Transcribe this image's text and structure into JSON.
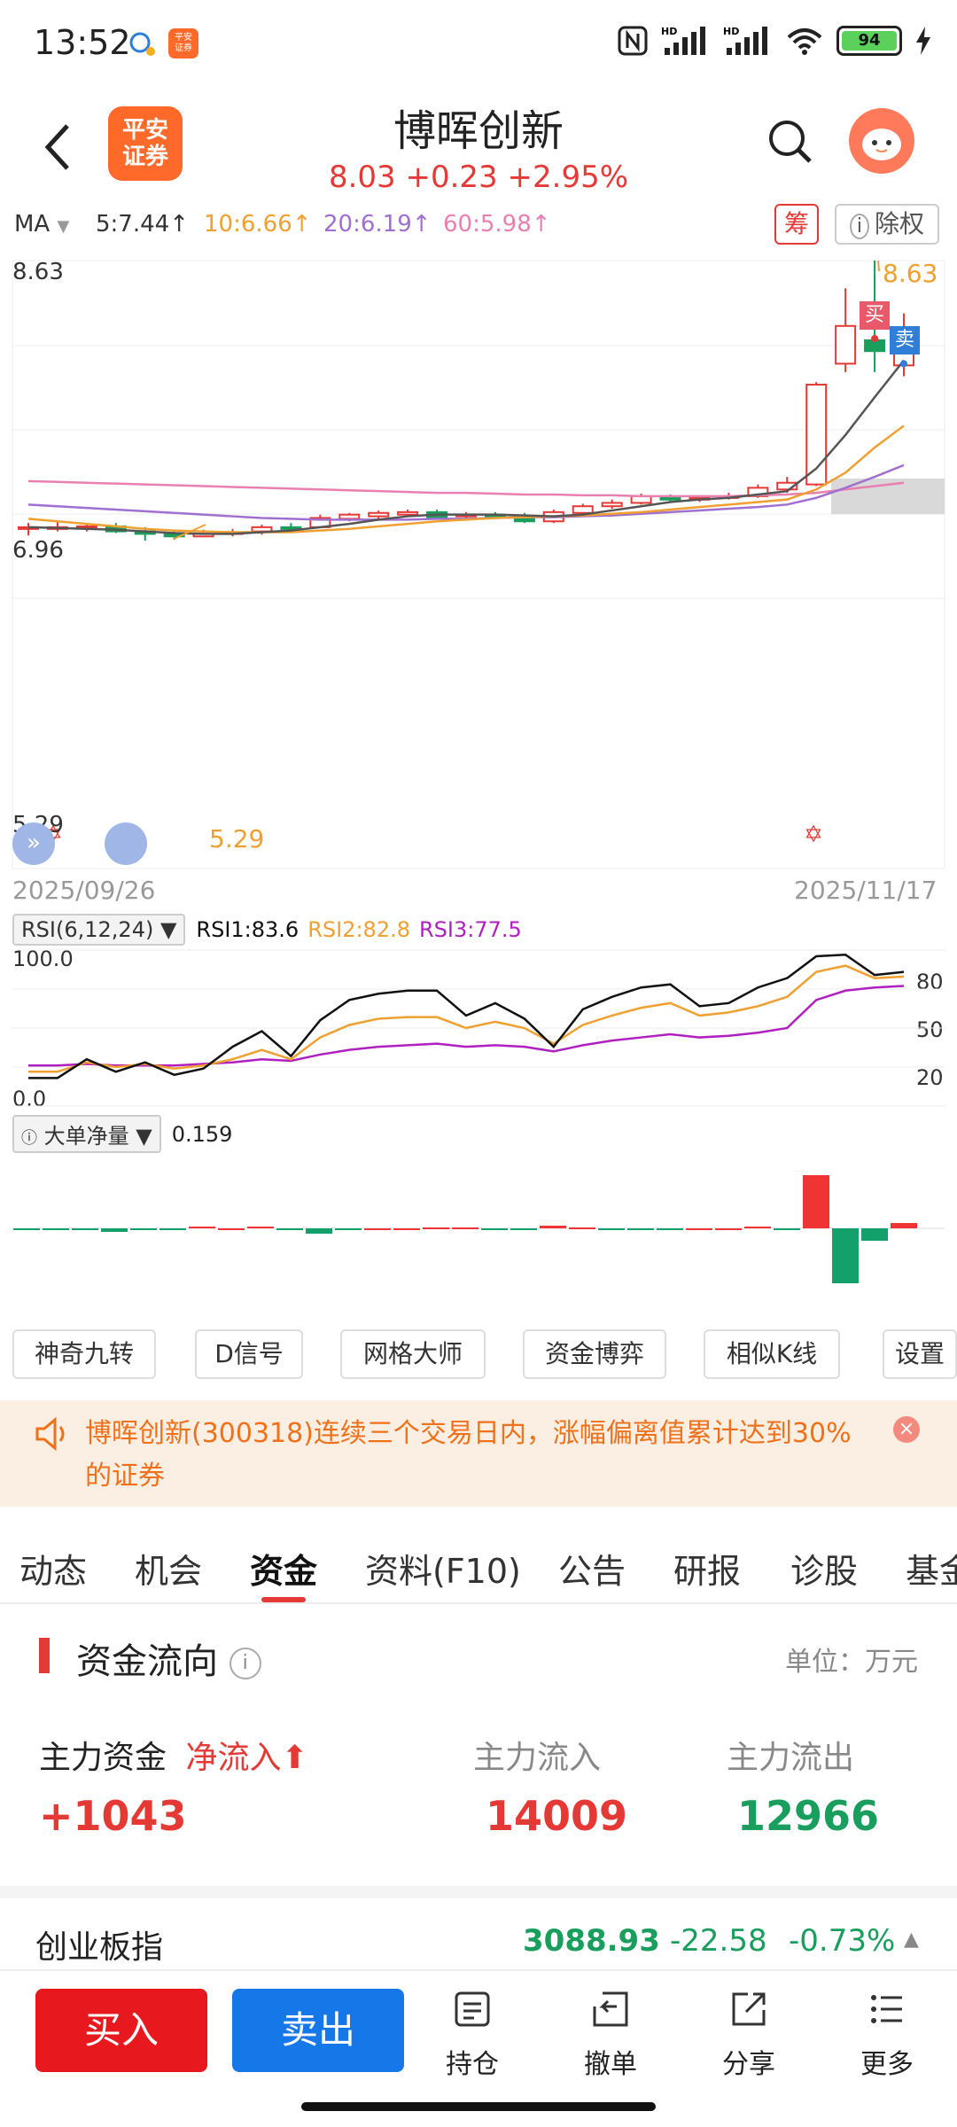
{
  "status": {
    "time": "13:52",
    "battery": "94",
    "app_badge": "平安证券"
  },
  "header": {
    "stock_name": "博晖创新",
    "price": "8.03",
    "change": "+0.23",
    "change_pct": "+2.95%",
    "logo_text": "平安证券"
  },
  "ma": {
    "label": "MA",
    "items": [
      "5:7.44↑",
      "10:6.66↑",
      "20:6.19↑",
      "60:5.98↑"
    ],
    "colors": [
      "#333333",
      "#f0a030",
      "#a070d0",
      "#e880b0"
    ],
    "chou_label": "筹",
    "chuquan_label": "除权"
  },
  "kline": {
    "y_high": "8.63",
    "y_mid": "6.96",
    "y_low": "5.29",
    "max_marker": "8.63",
    "min_marker": "5.29",
    "date_start": "2025/09/26",
    "date_end": "2025/11/17",
    "buy_tag": "买",
    "sell_tag": "卖"
  },
  "rsi": {
    "legend": "RSI(6,12,24)",
    "rsi1": "RSI1:83.6",
    "rsi2": "RSI2:82.8",
    "rsi3": "RSI3:77.5",
    "y_top": "100.0",
    "y_bottom": "0.0",
    "levels": [
      "80",
      "50",
      "20"
    ]
  },
  "big_order": {
    "legend": "大单净量",
    "value": "0.159"
  },
  "tools": [
    "神奇九转",
    "D信号",
    "网格大师",
    "资金博弈",
    "相似K线",
    "设置"
  ],
  "notice": {
    "text": "博晖创新(300318)连续三个交易日内，涨幅偏离值累计达到30%的证券"
  },
  "tabs": [
    "动态",
    "机会",
    "资金",
    "资料(F10)",
    "公告",
    "研报",
    "诊股",
    "基金"
  ],
  "fund_flow": {
    "title": "资金流向",
    "unit": "单位：万元",
    "main_label": "主力资金",
    "net_label": "净流入",
    "net_value": "+1043",
    "inflow_label": "主力流入",
    "inflow_value": "14009",
    "outflow_label": "主力流出",
    "outflow_value": "12966"
  },
  "index": {
    "name": "创业板指",
    "value": "3088.93",
    "change": "-22.58",
    "pct": "-0.73%"
  },
  "bottom_nav": {
    "buy": "买入",
    "sell": "卖出",
    "items": [
      "持仓",
      "撤单",
      "分享",
      "更多"
    ]
  }
}
